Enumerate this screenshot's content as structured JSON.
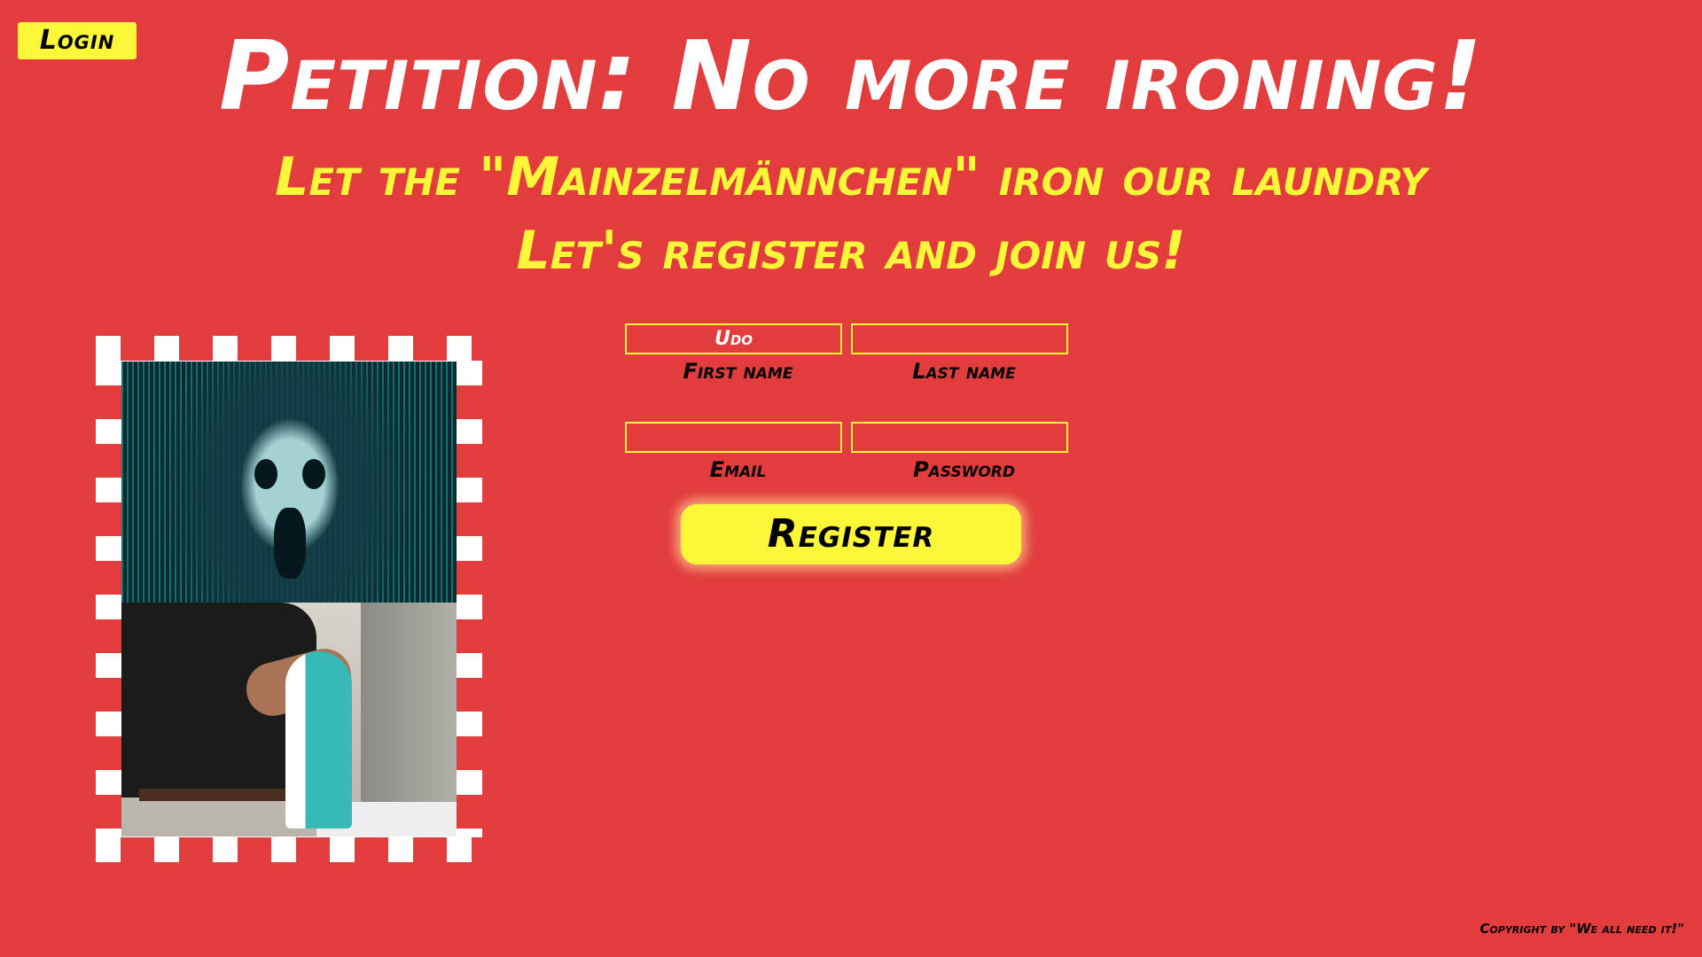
{
  "header": {
    "login_label": "Login",
    "title": "Petition: No more ironing!",
    "subtitle_line1": "Let the \"Mainzelmännchen\" iron our laundry",
    "subtitle_line2": "Let's register and join us!"
  },
  "form": {
    "first_name": {
      "value": "Udo",
      "label": "First name"
    },
    "last_name": {
      "value": "",
      "label": "Last name"
    },
    "email": {
      "value": "",
      "label": "Email"
    },
    "password": {
      "value": "",
      "label": "Password"
    },
    "register_label": "Register"
  },
  "footer": {
    "copyright": "Copyright by \"We all need it!\""
  },
  "colors": {
    "background": "#e23c3d",
    "accent_yellow": "#fdf73a",
    "title_white": "#ffffff",
    "text_black": "#000000"
  }
}
